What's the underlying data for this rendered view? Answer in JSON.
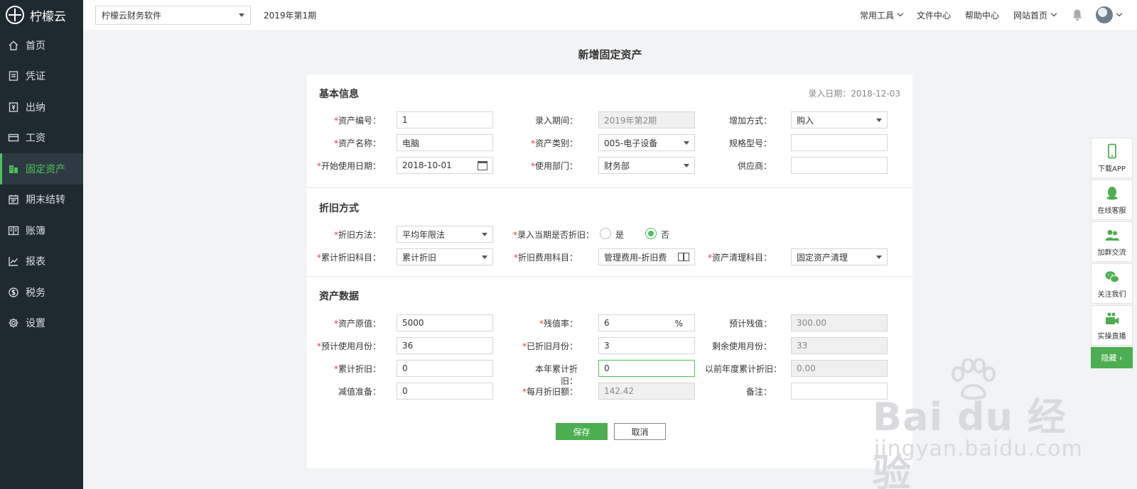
{
  "app": {
    "name": "柠檬云"
  },
  "sidebar": {
    "items": [
      {
        "label": "首页",
        "icon": "home-icon"
      },
      {
        "label": "凭证",
        "icon": "voucher-icon"
      },
      {
        "label": "出纳",
        "icon": "cashier-icon"
      },
      {
        "label": "工资",
        "icon": "salary-card-icon"
      },
      {
        "label": "固定资产",
        "icon": "building-icon",
        "active": true
      },
      {
        "label": "期末结转",
        "icon": "calendar-icon"
      },
      {
        "label": "账簿",
        "icon": "ledger-book-icon"
      },
      {
        "label": "报表",
        "icon": "line-chart-icon"
      },
      {
        "label": "税务",
        "icon": "tax-coin-icon"
      },
      {
        "label": "设置",
        "icon": "gear-icon"
      }
    ]
  },
  "topbar": {
    "company": "柠檬云财务软件",
    "period": "2019年第1期",
    "links": [
      "常用工具",
      "文件中心",
      "帮助中心",
      "网站首页"
    ]
  },
  "page": {
    "title": "新增固定资产"
  },
  "basic": {
    "title": "基本信息",
    "entry_date": "录入日期：2018-12-03",
    "asset_no_label": "资产编号：",
    "asset_no": "1",
    "entry_period_label": "录入期间：",
    "entry_period": "2019年第2期",
    "add_method_label": "增加方式：",
    "add_method": "购入",
    "asset_name_label": "资产名称：",
    "asset_name": "电脑",
    "asset_category_label": "资产类别：",
    "asset_category": "005-电子设备",
    "spec_label": "规格型号：",
    "spec": "",
    "start_date_label": "开始使用日期：",
    "start_date": "2018-10-01",
    "department_label": "使用部门：",
    "department": "财务部",
    "supplier_label": "供应商：",
    "supplier": ""
  },
  "depreciation": {
    "title": "折旧方式",
    "method_label": "折旧方法：",
    "method": "平均年限法",
    "current_period_label": "录入当期是否折旧：",
    "yes": "是",
    "no": "否",
    "selected": "否",
    "accum_subject_label": "累计折旧科目：",
    "accum_subject": "累计折旧",
    "expense_subject_label": "折旧费用科目：",
    "expense_subject": "管理费用-折旧费",
    "disposal_subject_label": "资产清理科目：",
    "disposal_subject": "固定资产清理"
  },
  "asset_data": {
    "title": "资产数据",
    "original_value_label": "资产原值：",
    "original_value": "5000",
    "residual_rate_label": "残值率：",
    "residual_rate": "6",
    "residual_rate_unit": "%",
    "est_residual_label": "预计残值：",
    "est_residual": "300.00",
    "est_months_label": "预计使用月份：",
    "est_months": "36",
    "depreciated_months_label": "已折旧月份：",
    "depreciated_months": "3",
    "remaining_months_label": "剩余使用月份：",
    "remaining_months": "33",
    "accum_dep_label": "累计折旧：",
    "accum_dep": "0",
    "year_dep_label": "本年累计折旧：",
    "year_dep": "0",
    "prev_year_dep_label": "以前年度累计折旧：",
    "prev_year_dep": "0.00",
    "impairment_label": "减值准备：",
    "impairment": "0",
    "monthly_dep_label": "每月折旧额：",
    "monthly_dep": "142.42",
    "remark_label": "备注：",
    "remark": ""
  },
  "buttons": {
    "save": "保存",
    "cancel": "取消"
  },
  "float_panel": {
    "items": [
      {
        "label": "下载APP",
        "icon": "mobile-phone-icon"
      },
      {
        "label": "在线客服",
        "icon": "qq-penguin-icon"
      },
      {
        "label": "加群交流",
        "icon": "group-users-icon"
      },
      {
        "label": "关注我们",
        "icon": "wechat-icon"
      },
      {
        "label": "实操直播",
        "icon": "video-camera-icon"
      }
    ],
    "hide": "隐藏 ›"
  },
  "watermark": {
    "brand": "Bai du 经验",
    "url": "jingyan.baidu.com"
  },
  "colors": {
    "accent": "#4cae50",
    "sidebar_bg": "#1f2a30",
    "required": "#e2393e"
  }
}
